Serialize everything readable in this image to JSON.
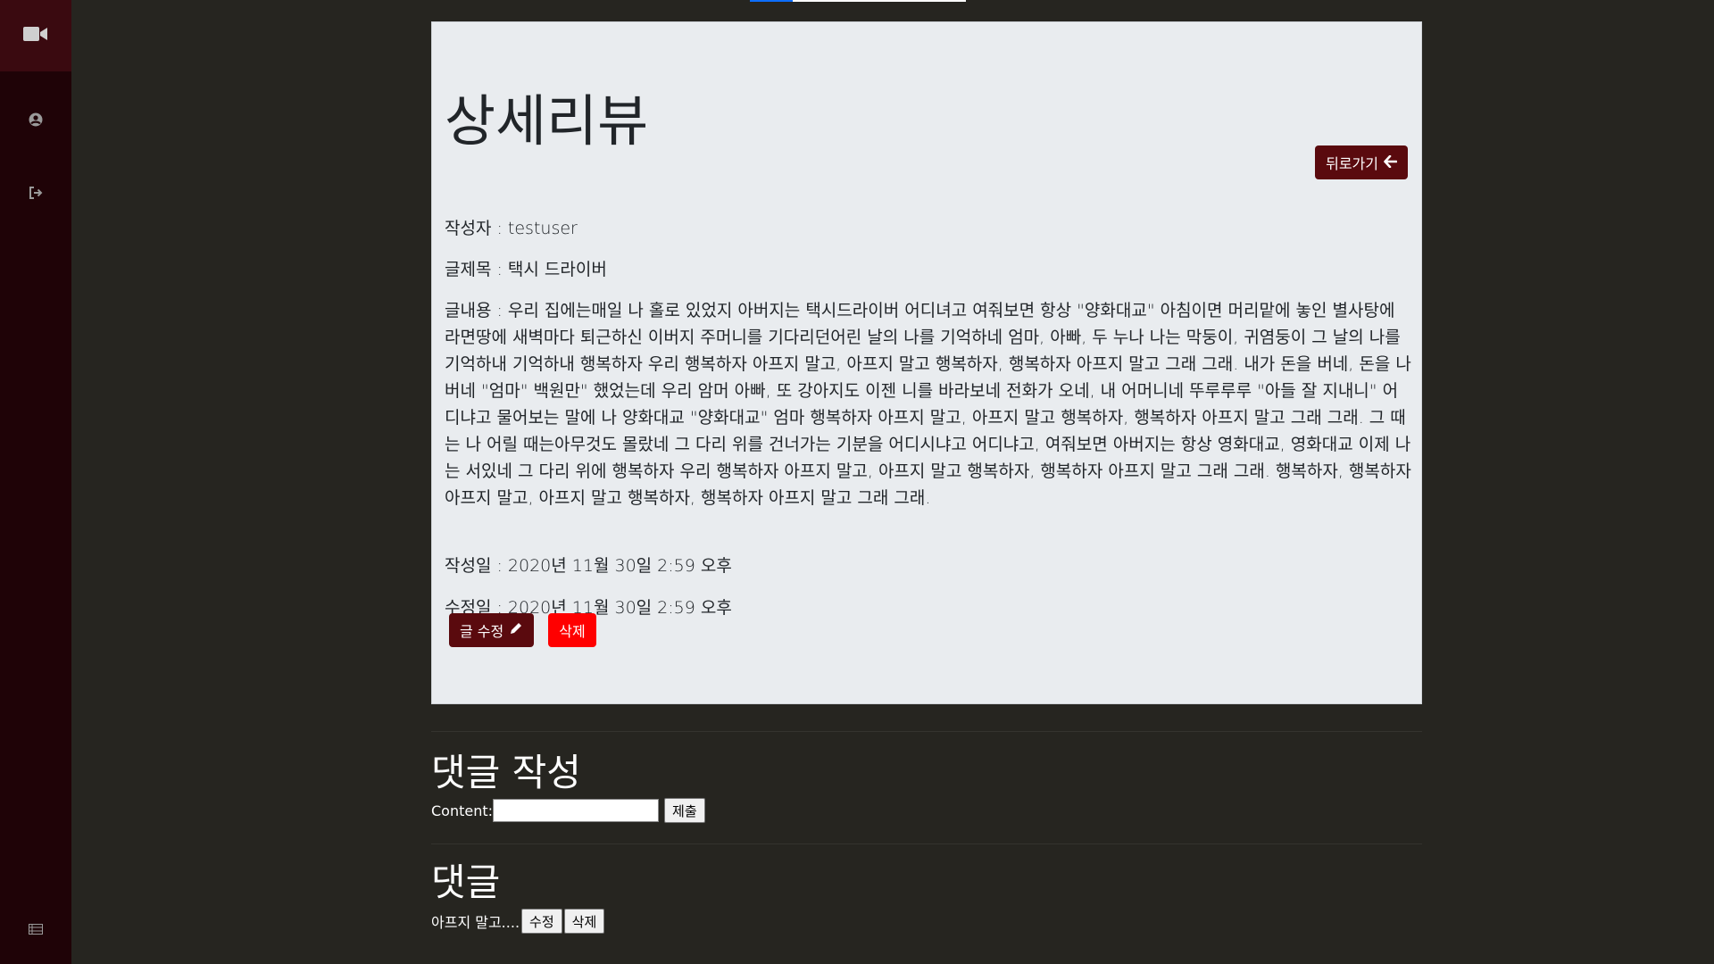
{
  "sidebar": {
    "items": [
      {
        "icon": "video-camera-icon"
      },
      {
        "icon": "user-circle-icon"
      },
      {
        "icon": "sign-out-icon"
      },
      {
        "icon": "list-icon"
      }
    ]
  },
  "colors": {
    "sidebar_bg": "#1f0307",
    "page_bg": "#262520",
    "primary_button": "#5a0a0e",
    "danger_button": "#ff0000"
  },
  "review": {
    "title": "상세리뷰",
    "back_label": "뒤로가기",
    "author_line": "작성자 : testuser",
    "subject_line": "글제목 : 택시 드라이버",
    "content_line": "글내용 : 우리 집에는매일 나 홀로 있었지 아버지는 택시드라이버 어디녀고 여줘보면 항상 \"양화대교\" 아침이면 머리맡에 놓인 별사탕에 라면땅에 새벽마다 퇴근하신 이버지 주머니를 기다리던어린 날의 나를 기억하네 엄마, 아빠, 두 누나 나는 막둥이, 귀염둥이 그 날의 나를 기억하내 기억하내 행복하자 우리 행복하자 아프지 말고, 아프지 말고 행복하자, 행복하자 아프지 말고 그래 그래. 내가 돈을 버네, 돈을 나 버네 \"엄마\" 백원만\" 했었는데 우리 암머 아빠, 또 강아지도 이젠 니를 바라보네 전화가 오네, 내 어머니네 뚜루루루 \"아들 잘 지내니\" 어디냐고 물어보는 말에 나 양화대교 \"양화대교\" 엄마 행복하자 아프지 말고, 아프지 말고 행복하자, 행복하자 아프지 말고 그래 그래. 그 때는 나 어릴 때는아무것도 몰랐네 그 다리 위를 건너가는 기분을 어디시냐고 어디냐고, 여줘보면 아버지는 항상 영화대교, 영화대교 이제 나는 서있네 그 다리 위에 행복하자 우리 행복하자 아프지 말고, 아프지 말고 행복하자, 행복하자 아프지 말고 그래 그래. 행복하자, 행복하자 아프지 말고, 아프지 말고 행복하자, 행복하자 아프지 말고 그래 그래.",
    "created_line": "작성일 : 2020년 11월 30일 2:59 오후",
    "modified_line": "수정일 : 2020년 11월 30일 2:59 오후",
    "edit_label": "글 수정",
    "delete_label": "삭제"
  },
  "comment_form": {
    "title": "댓글 작성",
    "content_label": "Content:",
    "content_value": "",
    "submit_label": "제출"
  },
  "comments": {
    "title": "댓글",
    "items": [
      {
        "text": "아프지 말고....",
        "edit_label": "수정",
        "delete_label": "삭제"
      }
    ]
  }
}
